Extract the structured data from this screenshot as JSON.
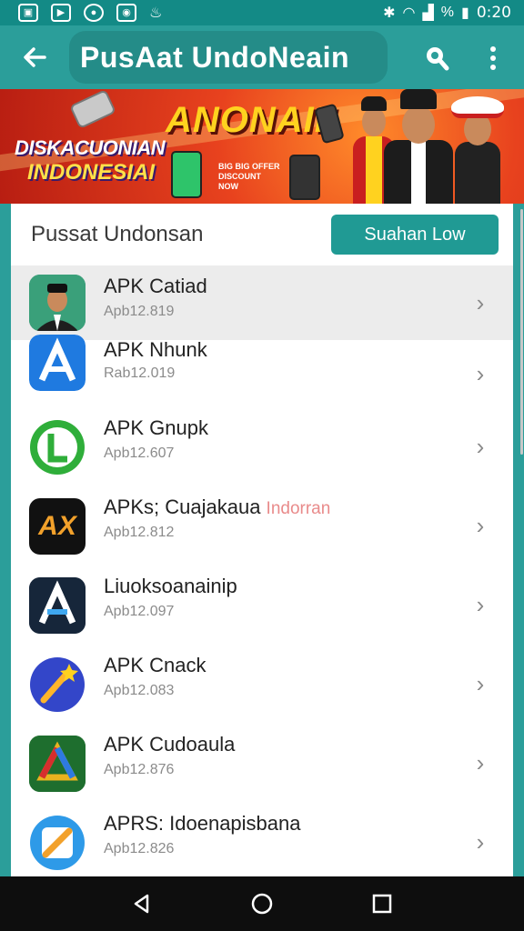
{
  "status_bar": {
    "time": "0:20",
    "left_icons": [
      "image-icon",
      "play-icon",
      "water-icon",
      "youtube-icon",
      "flame-icon"
    ],
    "right_icons": [
      "bluetooth-icon",
      "wifi-icon",
      "signal-icon",
      "battery-icon"
    ],
    "percent": "%"
  },
  "app_bar": {
    "title": "PusAat UndoNeain"
  },
  "banner": {
    "left_line1": "DISKACUONIAN",
    "left_line2": "INDONESIAI",
    "title": "ANONAIII",
    "small_text": "BIG BIG OFFER DISCOUNT NOW"
  },
  "card": {
    "title": "Pussat Undonsan",
    "button_label": "Suahan Low"
  },
  "apps": [
    {
      "name": "APK Catiad",
      "highlight": "",
      "version": "Apb12.819",
      "icon": "person-portrait-icon"
    },
    {
      "name": "APK Nhunk",
      "highlight": "",
      "version": "Rab12.019",
      "icon": "letter-a-blue-icon"
    },
    {
      "name": "APK Gnupk",
      "highlight": "",
      "version": "Apb12.607",
      "icon": "letter-l-green-icon"
    },
    {
      "name": "APKs; Cuajakaua ",
      "highlight": "Indorran",
      "version": "Apb12.812",
      "icon": "ax-orange-icon"
    },
    {
      "name": "Liuoksoanainip",
      "highlight": "",
      "version": "Apb12.097",
      "icon": "letter-a-dark-icon"
    },
    {
      "name": "APK Cnack",
      "highlight": "",
      "version": "Apb12.083",
      "icon": "wand-star-icon"
    },
    {
      "name": "APK Cudoaula",
      "highlight": "",
      "version": "Apb12.876",
      "icon": "tri-color-triangle-icon"
    },
    {
      "name": "APRS: Idoenapisbana",
      "highlight": "",
      "version": "Apb12.826",
      "icon": "pencil-blue-icon"
    }
  ],
  "colors": {
    "primary": "#2b9e9a",
    "status_bar": "#138a86",
    "button": "#209a94",
    "banner_red": "#e8421e",
    "banner_yellow": "#ffd21f"
  }
}
